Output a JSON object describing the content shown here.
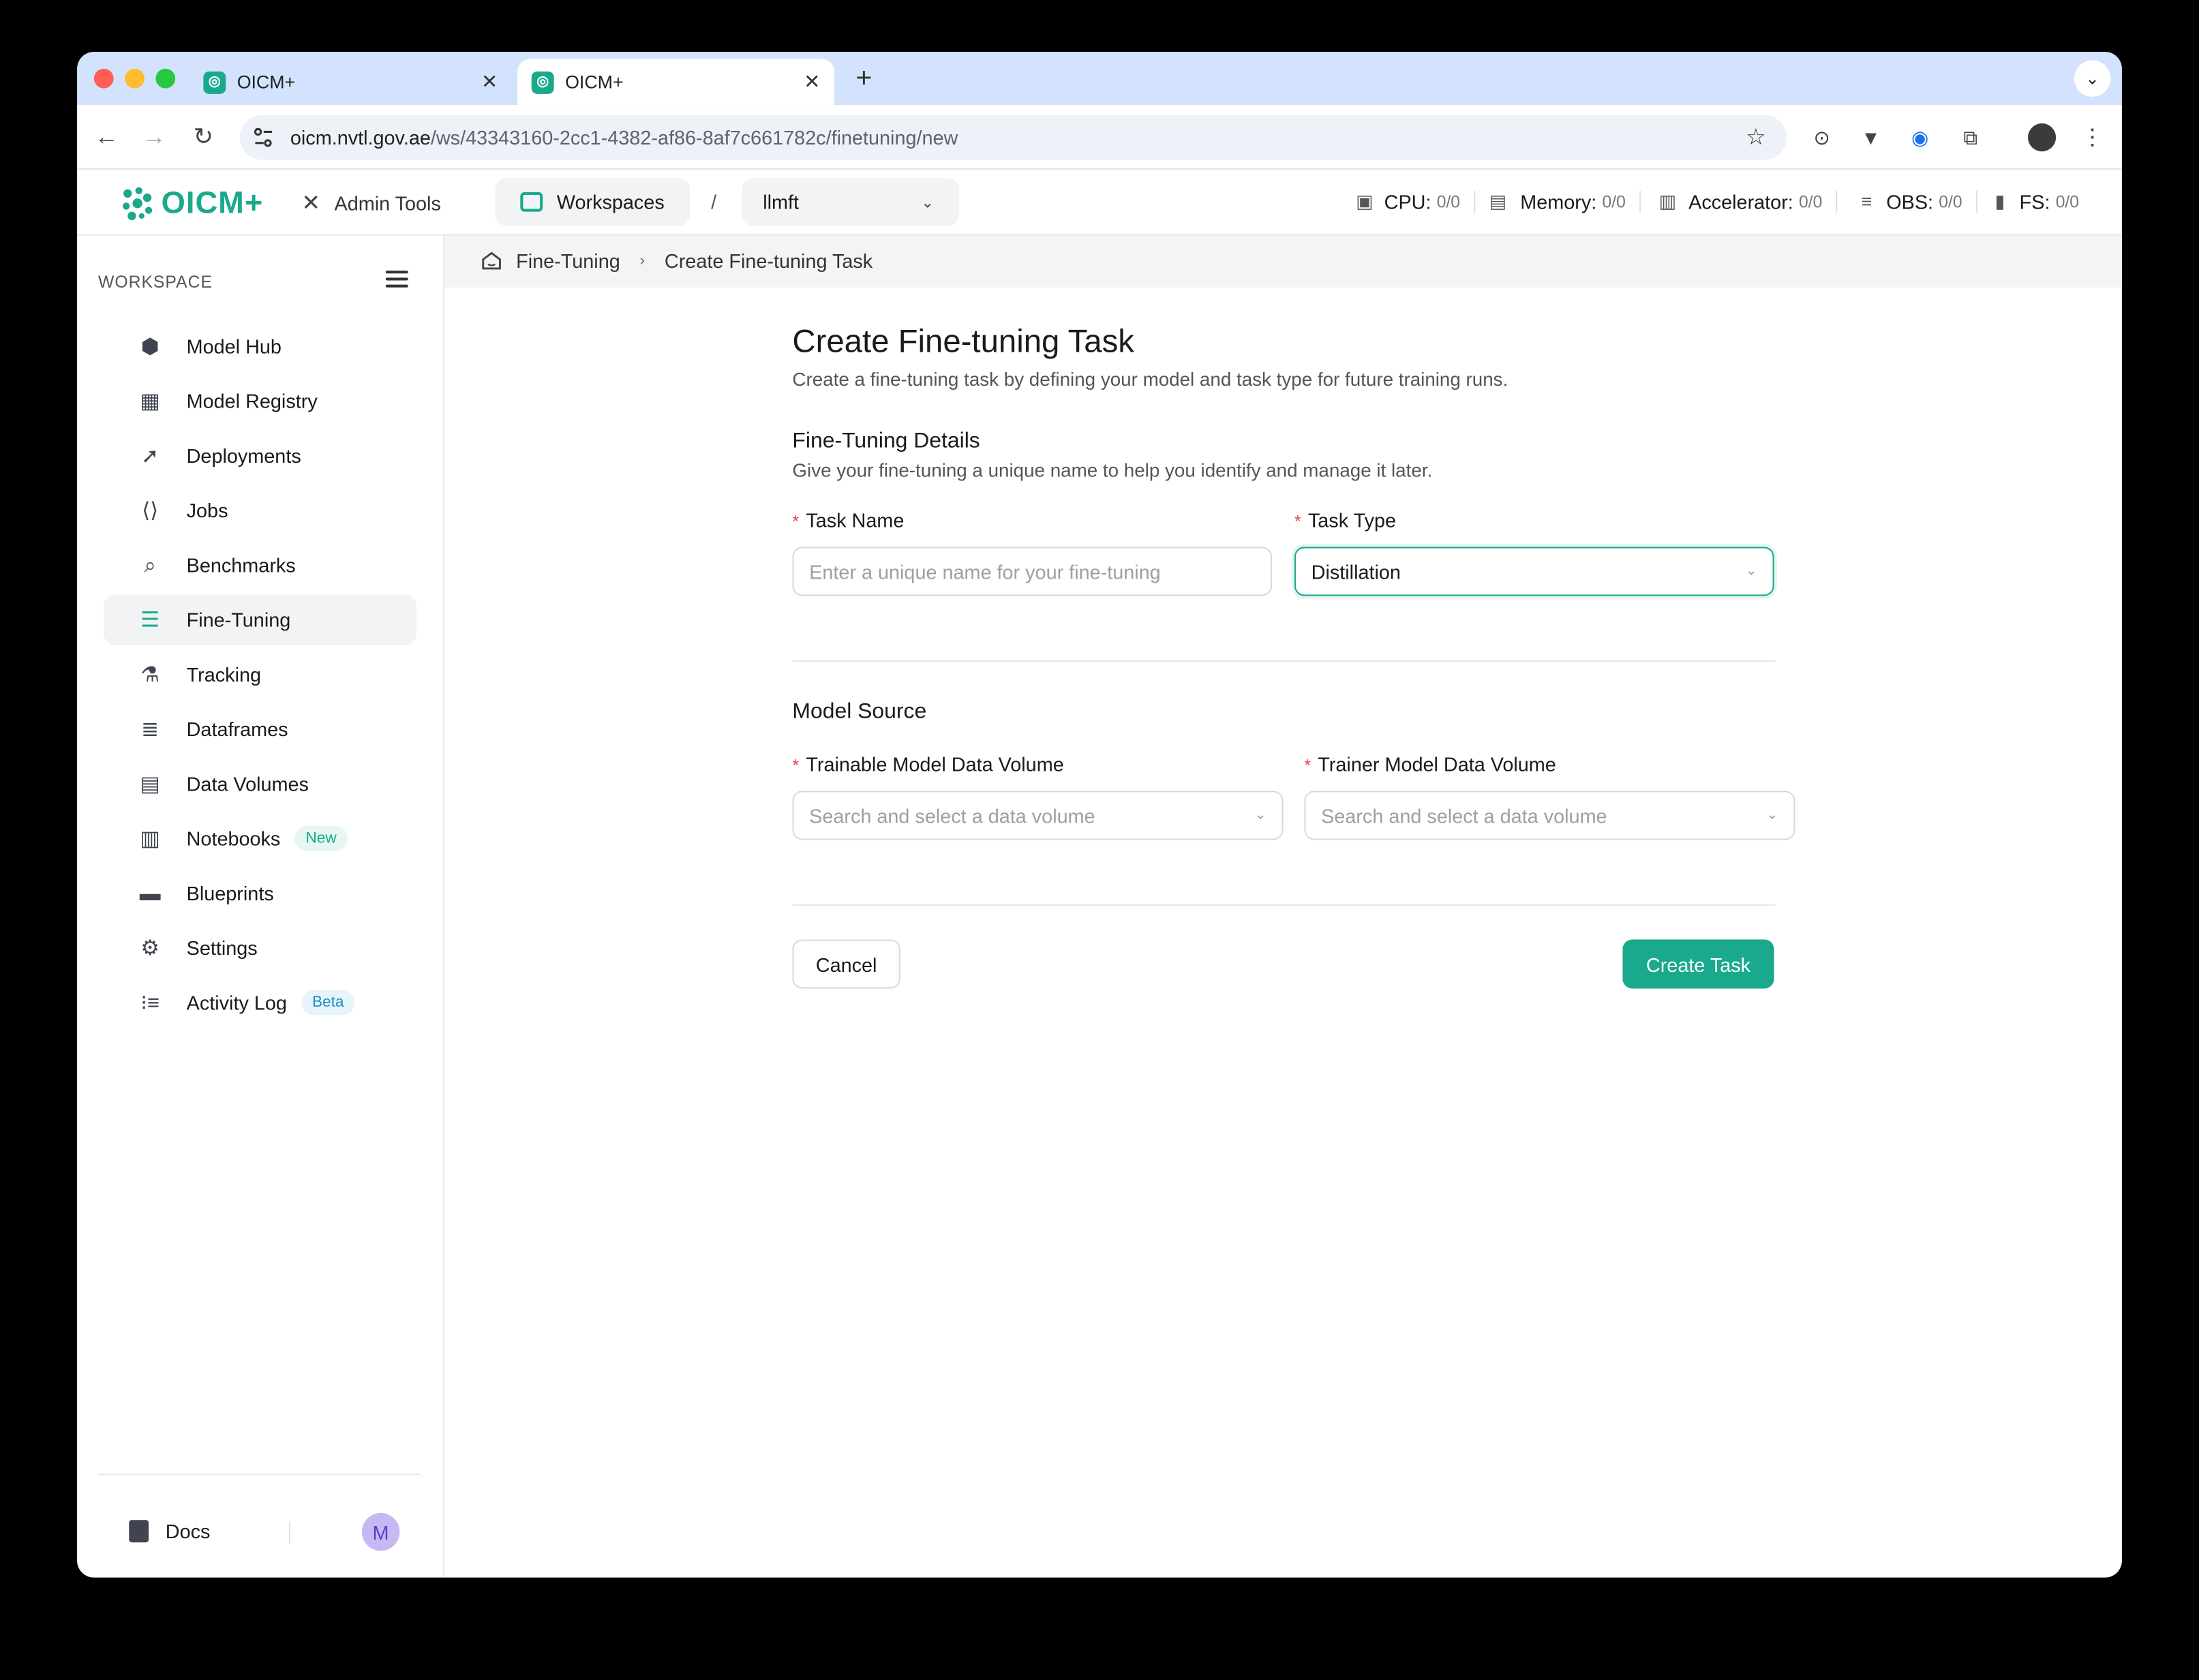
{
  "browser": {
    "tabs": [
      {
        "title": "OICM+",
        "active": false
      },
      {
        "title": "OICM+",
        "active": true
      }
    ],
    "url_host": "oicm.nvtl.gov.ae",
    "url_path": "/ws/43343160-2cc1-4382-af86-8af7c661782c/finetuning/new"
  },
  "appbar": {
    "logo": "OICM+",
    "admin_tools": "Admin Tools",
    "workspaces": "Workspaces",
    "separator": "/",
    "workspace_selected": "llmft",
    "resources": [
      {
        "label": "CPU:",
        "value": "0/0",
        "icon": "cpu-icon"
      },
      {
        "label": "Memory:",
        "value": "0/0",
        "icon": "memory-icon"
      },
      {
        "label": "Accelerator:",
        "value": "0/0",
        "icon": "accelerator-icon"
      },
      {
        "label": "OBS:",
        "value": "0/0",
        "icon": "database-icon"
      },
      {
        "label": "FS:",
        "value": "0/0",
        "icon": "file-icon"
      }
    ]
  },
  "sidebar": {
    "section_label": "WORKSPACE",
    "items": [
      {
        "label": "Model Hub",
        "icon": "cube-icon"
      },
      {
        "label": "Model Registry",
        "icon": "registry-icon"
      },
      {
        "label": "Deployments",
        "icon": "rocket-icon"
      },
      {
        "label": "Jobs",
        "icon": "code-icon"
      },
      {
        "label": "Benchmarks",
        "icon": "chart-search-icon"
      },
      {
        "label": "Fine-Tuning",
        "icon": "sliders-icon",
        "selected": true
      },
      {
        "label": "Tracking",
        "icon": "flask-icon"
      },
      {
        "label": "Dataframes",
        "icon": "database-icon"
      },
      {
        "label": "Data Volumes",
        "icon": "volumes-icon"
      },
      {
        "label": "Notebooks",
        "icon": "notebook-icon",
        "badge": "New"
      },
      {
        "label": "Blueprints",
        "icon": "blueprint-icon"
      },
      {
        "label": "Settings",
        "icon": "gear-icon"
      },
      {
        "label": "Activity Log",
        "icon": "list-icon",
        "badge": "Beta"
      }
    ],
    "docs": "Docs",
    "avatar_initial": "M"
  },
  "breadcrumb": {
    "parent": "Fine-Tuning",
    "current": "Create Fine-tuning Task"
  },
  "form": {
    "title": "Create Fine-tuning Task",
    "subtitle": "Create a fine-tuning task by defining your model and task type for future training runs.",
    "details_heading": "Fine-Tuning Details",
    "details_sub": "Give your fine-tuning a unique name to help you identify and manage it later.",
    "task_name_label": "Task Name",
    "task_name_placeholder": "Enter a unique name for your fine-tuning",
    "task_type_label": "Task Type",
    "task_type_value": "Distillation",
    "model_source_heading": "Model Source",
    "trainable_label": "Trainable Model Data Volume",
    "trainable_placeholder": "Search and select a data volume",
    "trainer_label": "Trainer Model Data Volume",
    "trainer_placeholder": "Search and select a data volume",
    "required_marker": "*",
    "cancel": "Cancel",
    "create": "Create Task"
  },
  "colors": {
    "accent": "#1aa98c",
    "tabbar": "#d3e3fd",
    "required": "#e5484d"
  }
}
